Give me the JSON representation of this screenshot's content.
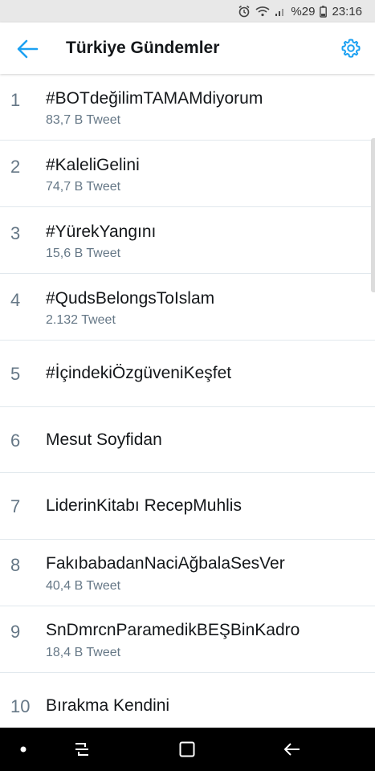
{
  "status_bar": {
    "battery": "%29",
    "time": "23:16"
  },
  "header": {
    "title": "Türkiye Gündemler"
  },
  "trends": [
    {
      "rank": "1",
      "name": "#BOTdeğilimTAMAMdiyorum",
      "count": "83,7 B Tweet"
    },
    {
      "rank": "2",
      "name": "#KaleliGelini",
      "count": "74,7 B Tweet"
    },
    {
      "rank": "3",
      "name": "#YürekYangını",
      "count": "15,6 B Tweet"
    },
    {
      "rank": "4",
      "name": "#QudsBelongsToIslam",
      "count": "2.132 Tweet"
    },
    {
      "rank": "5",
      "name": "#İçindekiÖzgüveniKeşfet",
      "count": ""
    },
    {
      "rank": "6",
      "name": "Mesut Soyfidan",
      "count": ""
    },
    {
      "rank": "7",
      "name": "LiderinKitabı RecepMuhlis",
      "count": ""
    },
    {
      "rank": "8",
      "name": "FakıbabadanNaciAğbalaSesVer",
      "count": "40,4 B Tweet"
    },
    {
      "rank": "9",
      "name": "SnDmrcnParamedikBEŞBinKadro",
      "count": "18,4 B Tweet"
    },
    {
      "rank": "10",
      "name": "Bırakma Kendini",
      "count": ""
    }
  ],
  "icons": {
    "back": "arrow-left-icon",
    "settings": "gear-icon",
    "nav_dot": "dot-icon",
    "nav_recents": "recent-apps-icon",
    "nav_home": "home-icon",
    "nav_back": "back-icon"
  },
  "colors": {
    "accent": "#1da1f2",
    "secondary_text": "#657786",
    "divider": "#e1e8ed"
  }
}
